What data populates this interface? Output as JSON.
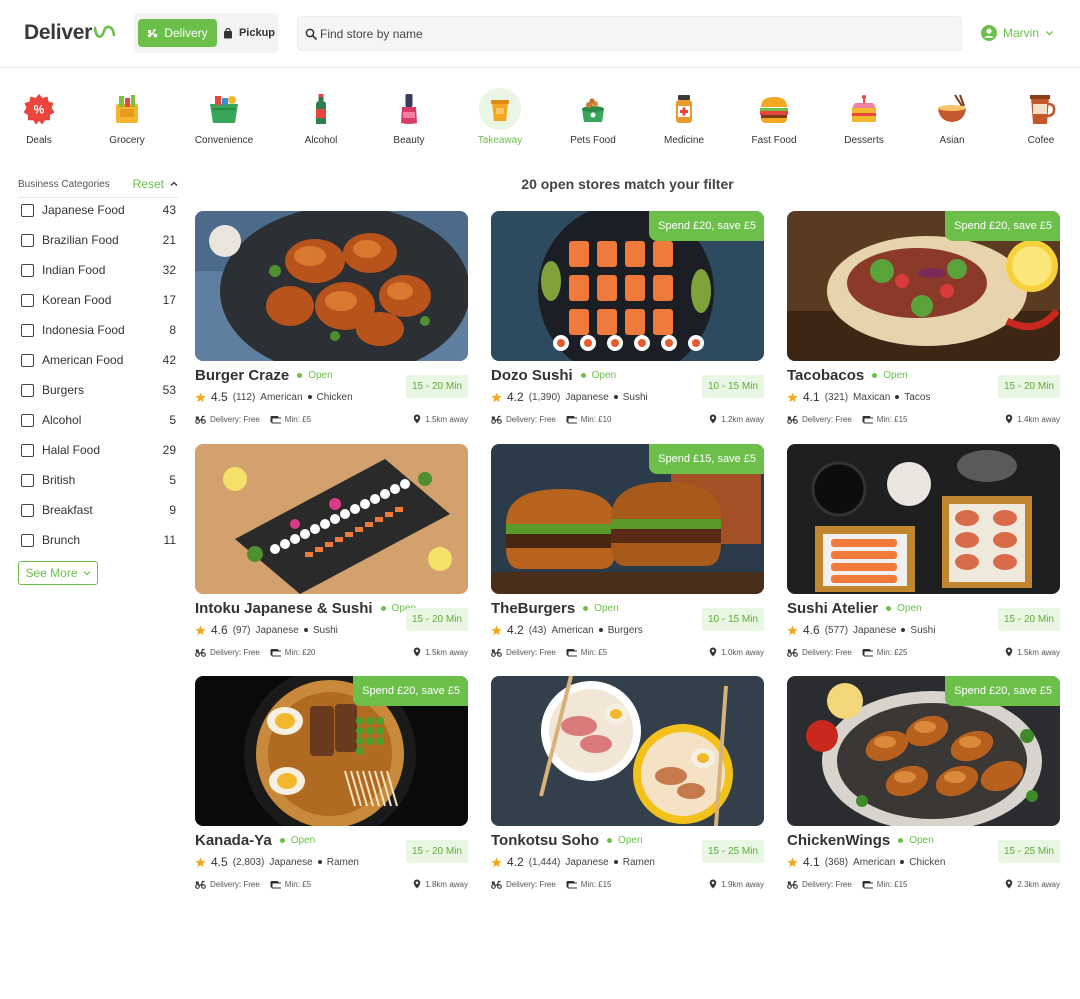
{
  "header": {
    "logo_text": "Deliver",
    "delivery_label": "Delivery",
    "pickup_label": "Pickup",
    "search_placeholder": "Find store by name",
    "user_name": "Marvin"
  },
  "categories": [
    {
      "label": "Deals",
      "icon": "deals-icon"
    },
    {
      "label": "Grocery",
      "icon": "grocery-icon"
    },
    {
      "label": "Convenience",
      "icon": "convenience-icon"
    },
    {
      "label": "Alcohol",
      "icon": "alcohol-icon"
    },
    {
      "label": "Beauty",
      "icon": "beauty-icon"
    },
    {
      "label": "Takeaway",
      "icon": "takeaway-icon",
      "active": true
    },
    {
      "label": "Pets Food",
      "icon": "pets-food-icon"
    },
    {
      "label": "Medicine",
      "icon": "medicine-icon"
    },
    {
      "label": "Fast Food",
      "icon": "fast-food-icon"
    },
    {
      "label": "Desserts",
      "icon": "desserts-icon"
    },
    {
      "label": "Asian",
      "icon": "asian-icon"
    },
    {
      "label": "Cofee",
      "icon": "coffee-icon"
    }
  ],
  "sidebar": {
    "title": "Business Categories",
    "reset_label": "Reset",
    "filters": [
      {
        "label": "Japanese Food",
        "count": "43"
      },
      {
        "label": "Brazilian Food",
        "count": "21"
      },
      {
        "label": "Indian Food",
        "count": "32"
      },
      {
        "label": "Korean Food",
        "count": "17"
      },
      {
        "label": "Indonesia Food",
        "count": "8"
      },
      {
        "label": "American Food",
        "count": "42"
      },
      {
        "label": "Burgers",
        "count": "53"
      },
      {
        "label": "Alcohol",
        "count": "5"
      },
      {
        "label": "Halal Food",
        "count": "29"
      },
      {
        "label": "British",
        "count": "5"
      },
      {
        "label": "Breakfast",
        "count": "9"
      },
      {
        "label": "Brunch",
        "count": "11"
      }
    ],
    "see_more_label": "See More"
  },
  "results": {
    "title": "20 open stores match your filter",
    "open_label": "Open",
    "stores": [
      {
        "name": "Burger Craze",
        "rating": "4.5",
        "reviews": "(112)",
        "cuisine": "American",
        "dish": "Chicken",
        "time": "15 - 20 Min",
        "delivery": "Delivery: Free",
        "min": "Min: £5",
        "distance": "1.5km away",
        "promo": ""
      },
      {
        "name": "Dozo Sushi",
        "rating": "4.2",
        "reviews": "(1,390)",
        "cuisine": "Japanese",
        "dish": "Sushi",
        "time": "10 - 15 Min",
        "delivery": "Delivery: Free",
        "min": "Min: £10",
        "distance": "1.2km away",
        "promo": "Spend £20, save £5"
      },
      {
        "name": "Tacobacos",
        "rating": "4.1",
        "reviews": "(321)",
        "cuisine": "Maxican",
        "dish": "Tacos",
        "time": "15 - 20 Min",
        "delivery": "Delivery: Free",
        "min": "Min: £15",
        "distance": "1.4km away",
        "promo": "Spend £20, save £5"
      },
      {
        "name": "Intoku Japanese & Sushi",
        "rating": "4.6",
        "reviews": "(97)",
        "cuisine": "Japanese",
        "dish": "Sushi",
        "time": "15 - 20 Min",
        "delivery": "Delivery: Free",
        "min": "Min: £20",
        "distance": "1.5km away",
        "promo": ""
      },
      {
        "name": "TheBurgers",
        "rating": "4.2",
        "reviews": "(43)",
        "cuisine": "American",
        "dish": "Burgers",
        "time": "10 - 15 Min",
        "delivery": "Delivery: Free",
        "min": "Min: £5",
        "distance": "1.0km away",
        "promo": "Spend £15, save £5"
      },
      {
        "name": "Sushi Atelier",
        "rating": "4.6",
        "reviews": "(577)",
        "cuisine": "Japanese",
        "dish": "Sushi",
        "time": "15 - 20 Min",
        "delivery": "Delivery: Free",
        "min": "Min: £25",
        "distance": "1.5km away",
        "promo": ""
      },
      {
        "name": "Kanada-Ya",
        "rating": "4.5",
        "reviews": "(2,803)",
        "cuisine": "Japanese",
        "dish": "Ramen",
        "time": "15 - 20 Min",
        "delivery": "Delivery: Free",
        "min": "Min: £5",
        "distance": "1.8km away",
        "promo": "Spend £20, save £5"
      },
      {
        "name": "Tonkotsu Soho",
        "rating": "4.2",
        "reviews": "(1,444)",
        "cuisine": "Japanese",
        "dish": "Ramen",
        "time": "15 - 25 Min",
        "delivery": "Delivery: Free",
        "min": "Min: £15",
        "distance": "1.9km away",
        "promo": ""
      },
      {
        "name": "ChickenWings",
        "rating": "4.1",
        "reviews": "(368)",
        "cuisine": "American",
        "dish": "Chicken",
        "time": "15 - 25 Min",
        "delivery": "Delivery: Free",
        "min": "Min: £15",
        "distance": "2.3km away",
        "promo": "Spend £20, save £5"
      }
    ]
  },
  "colors": {
    "accent": "#6cc04a",
    "accent_light": "#e9f6e3",
    "star": "#f5a623"
  }
}
